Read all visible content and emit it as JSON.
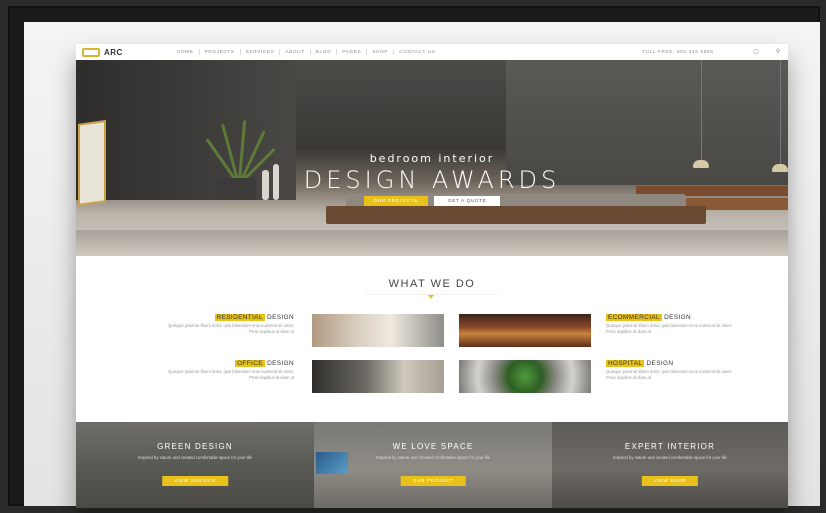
{
  "brand": {
    "name": "ARC"
  },
  "nav": {
    "items": [
      "HOME",
      "PROJECTS",
      "SERVICES",
      "ABOUT",
      "BLOG",
      "PAGES",
      "SHOP",
      "CONTACT US"
    ],
    "toll": "TOLL FREE: 800 345 6889"
  },
  "hero": {
    "subtitle": "bedroom interior",
    "title": "DESIGN AWARDS",
    "btn_primary": "OUR PROJECTS",
    "btn_secondary": "GET A QUOTE"
  },
  "what_we_do": {
    "title": "WHAT WE DO",
    "services": [
      {
        "highlight": "RESIDENTIAL",
        "suffix": "DESIGN",
        "desc": "Quisque pulvinar libero dolor, quis bibendum eros euismod sit amet. Proin dapibus id diam at"
      },
      {
        "highlight": "ECOMMERCIAL",
        "suffix": "DESIGN",
        "desc": "Quisque pulvinar libero dolor, quis bibendum eros euismod sit amet. Proin dapibus id diam at"
      },
      {
        "highlight": "OFFICE",
        "suffix": "DESIGN",
        "desc": "Quisque pulvinar libero dolor, quis bibendum eros euismod sit amet. Proin dapibus id diam at"
      },
      {
        "highlight": "HOSPITAL",
        "suffix": "DESIGN",
        "desc": "Quisque pulvinar libero dolor, quis bibendum eros euismod sit amet. Proin dapibus id diam at"
      }
    ]
  },
  "panels": [
    {
      "title": "GREEN DESIGN",
      "desc": "Inspired by nature and created comfortable space for your life",
      "btn": "VIEW SERVICE"
    },
    {
      "title": "WE LOVE SPACE",
      "desc": "Inspired by nature and created comfortable space for your life",
      "btn": "OUR PROJECT"
    },
    {
      "title": "EXPERT INTERIOR",
      "desc": "Inspired by nature and created comfortable space for your life",
      "btn": "VIEW SHOP"
    }
  ],
  "colors": {
    "accent": "#e8c21b",
    "frame": "#1b1b1b"
  },
  "icons": {
    "cart": "cart-icon",
    "search": "search-icon"
  }
}
